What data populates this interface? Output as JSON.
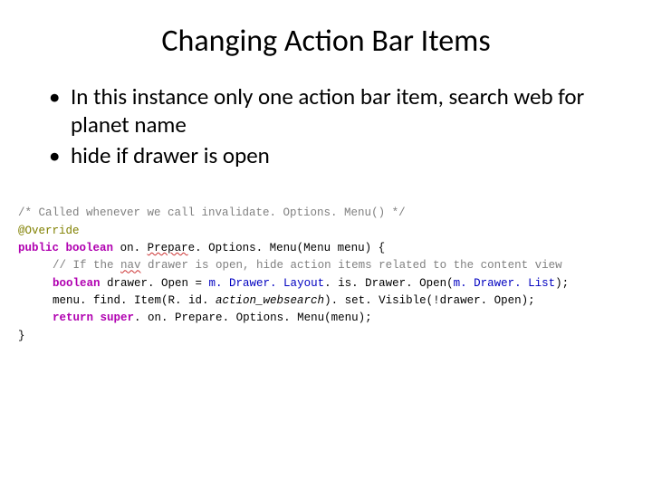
{
  "title": "Changing Action Bar Items",
  "bullets": {
    "b1": "In this instance only one action bar item, search web for planet name",
    "b2": "hide if drawer is open"
  },
  "code": {
    "line1_comment": "/* Called whenever we call invalidate. Options. Menu() */",
    "line2_annotation": "@Override",
    "line3": {
      "kw_public": "public",
      "kw_boolean": "boolean",
      "method_part1": "on. ",
      "method_squiggle": "Prepar",
      "method_part2": "e. Options. Menu(Menu menu) {"
    },
    "line4": {
      "comment_part1": "// If the ",
      "comment_squiggle": "nav",
      "comment_part2": " drawer is open, hide action items related to the content view"
    },
    "line5": {
      "kw_boolean": "boolean",
      "var": " drawer. Open = ",
      "field1": "m. Drawer. Layout",
      "call1": ". is. Drawer. Open(",
      "field2": "m. Drawer. List",
      "end": ");"
    },
    "line6": {
      "part1": "menu. find. Item(R. id. ",
      "static": "action_websearch",
      "part2": "). set. Visible(!drawer. Open);"
    },
    "line7": {
      "kw_return": "return",
      "kw_super": "super",
      "rest": ". on. Prepare. Options. Menu(menu);"
    },
    "line8": "}"
  }
}
